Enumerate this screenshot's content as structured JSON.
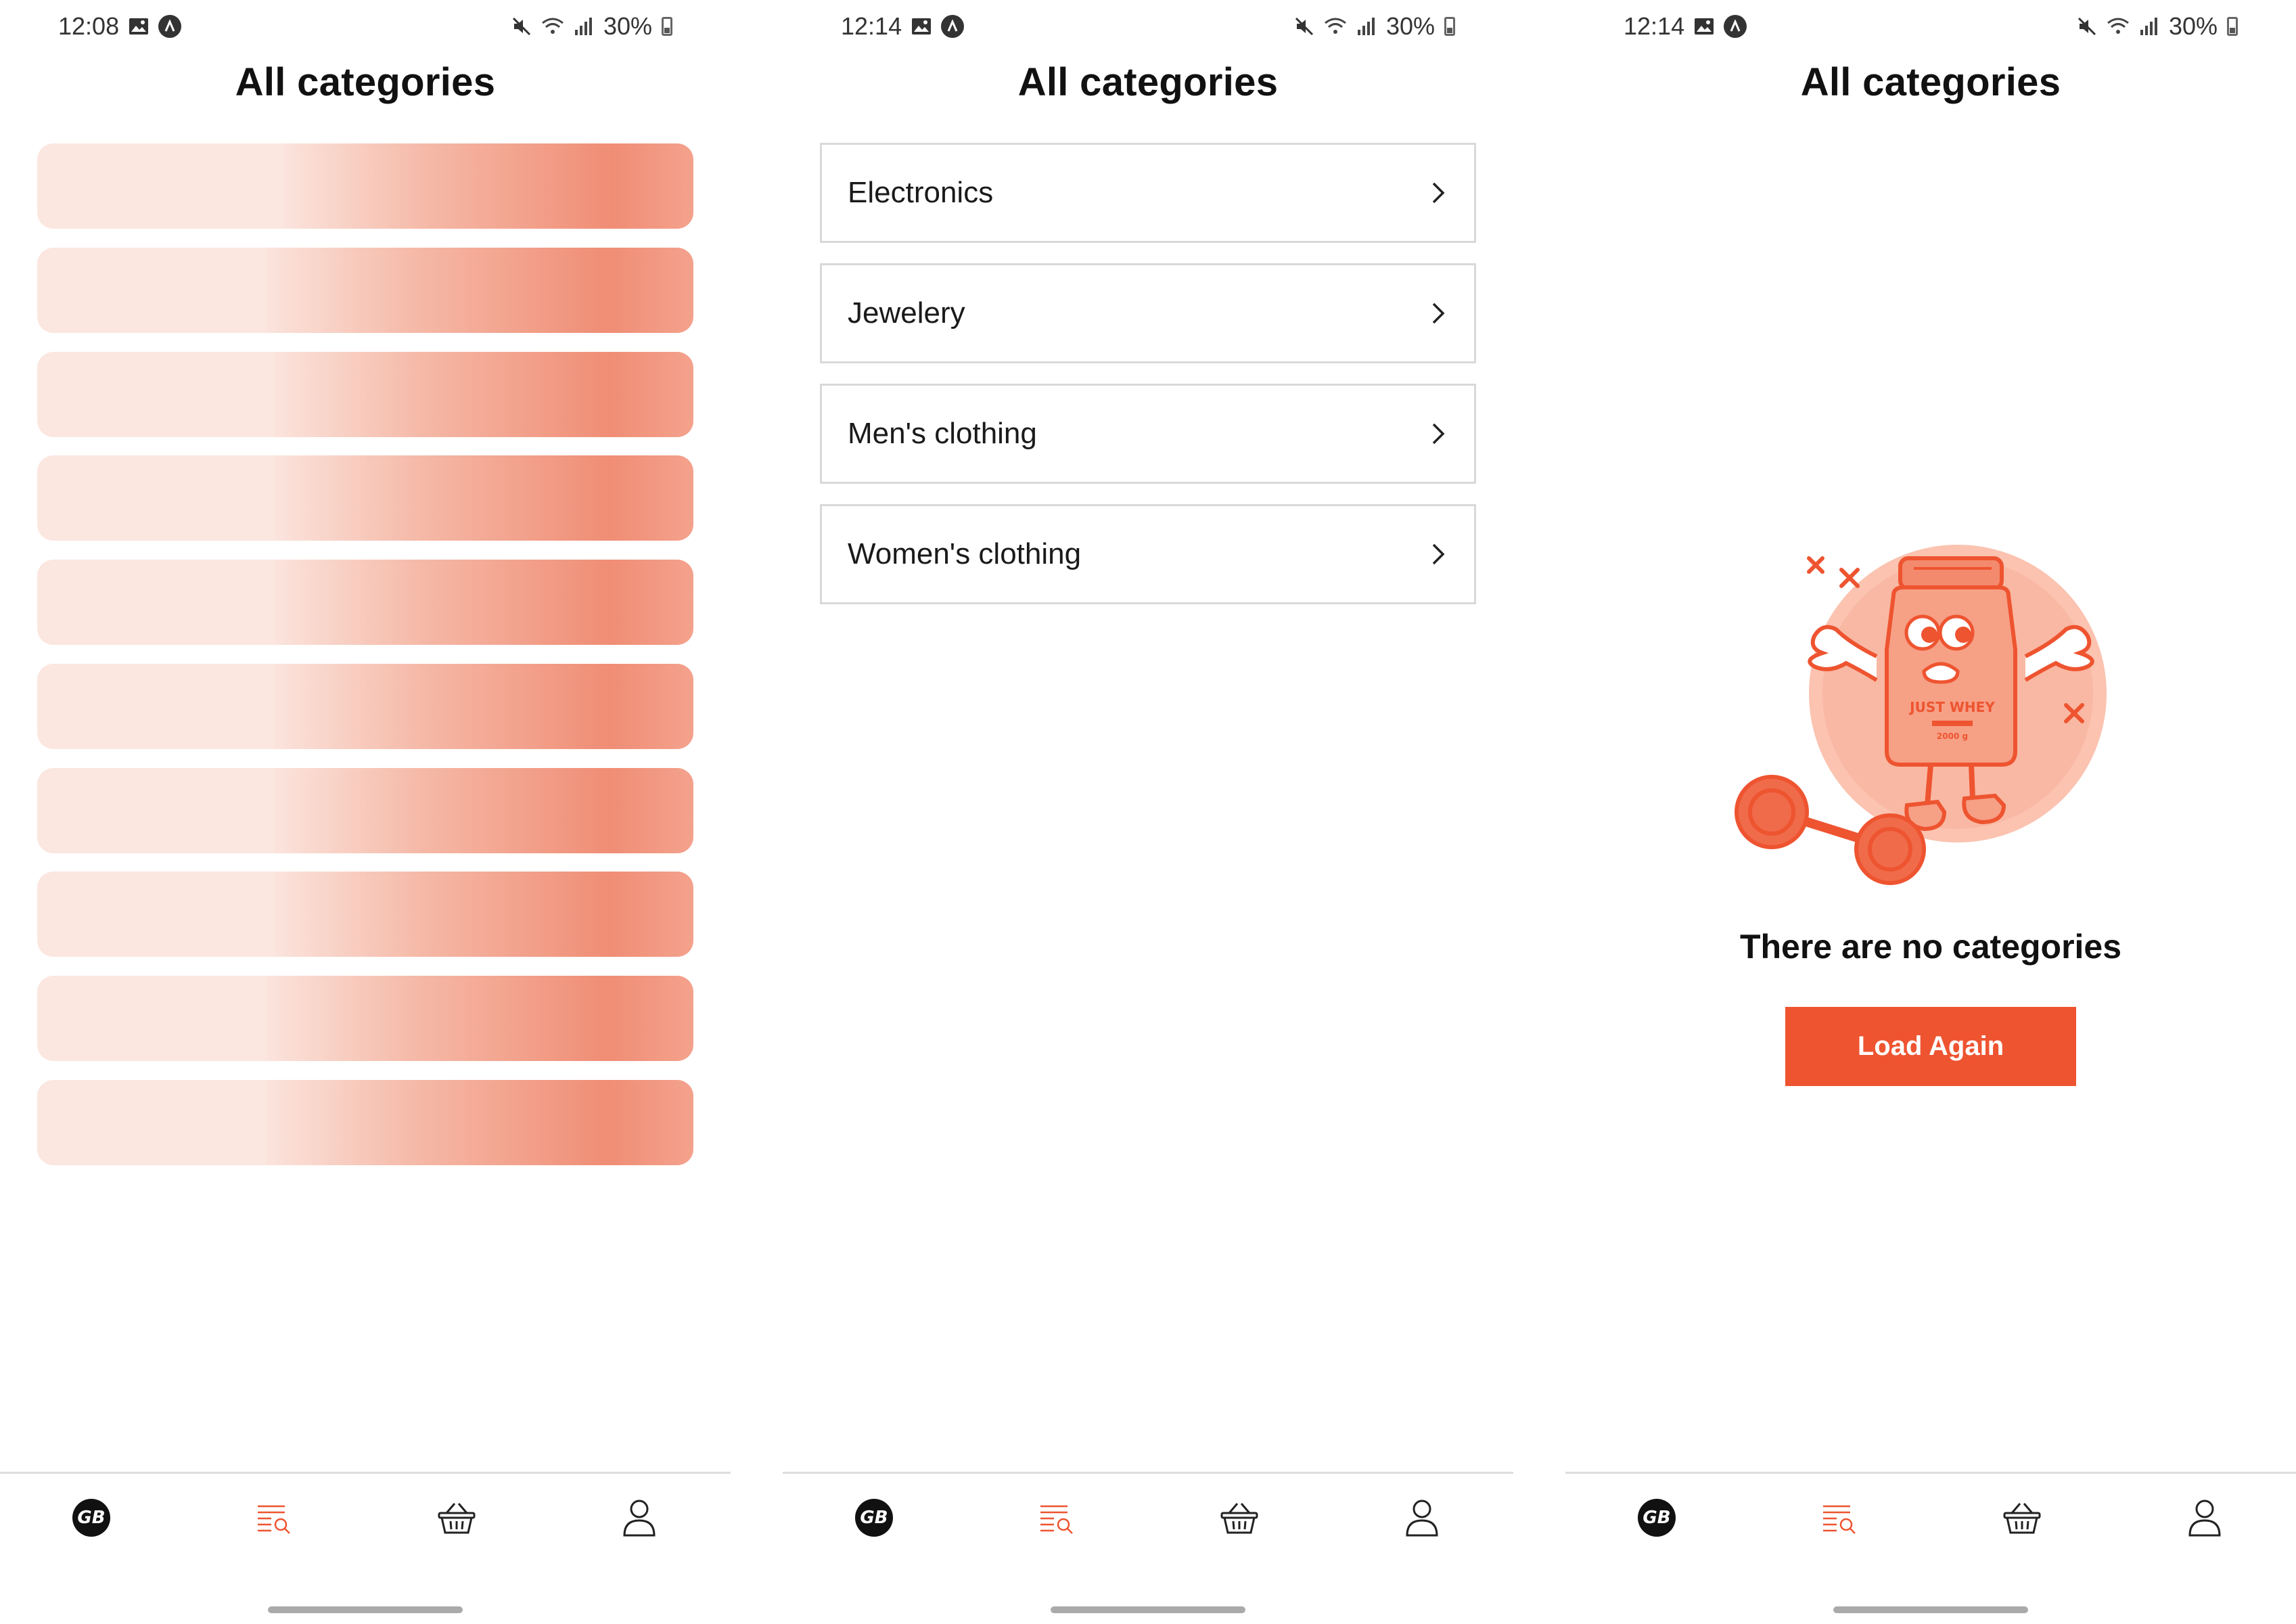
{
  "colors": {
    "accent": "#ee5430",
    "skeleton_light": "#fbe6e0",
    "skeleton_dark": "#f08d75",
    "border": "#d9d9d9",
    "text": "#111111"
  },
  "screens": [
    {
      "status": {
        "time": "12:08",
        "battery": "30%"
      },
      "title": "All categories",
      "state": "loading",
      "skeleton_count": 10
    },
    {
      "status": {
        "time": "12:14",
        "battery": "30%"
      },
      "title": "All categories",
      "state": "loaded",
      "categories": [
        {
          "label": "Electronics"
        },
        {
          "label": "Jewelery"
        },
        {
          "label": "Men's clothing"
        },
        {
          "label": "Women's clothing"
        }
      ]
    },
    {
      "status": {
        "time": "12:14",
        "battery": "30%"
      },
      "title": "All categories",
      "state": "empty",
      "empty_message": "There are no categories",
      "reload_label": "Load Again",
      "illustration": {
        "jar_label": "JUST WHEY",
        "jar_weight": "2000 g"
      }
    }
  ],
  "nav": {
    "logo": "GB",
    "items": [
      {
        "icon": "gb-logo-icon"
      },
      {
        "icon": "categories-search-icon",
        "active": true
      },
      {
        "icon": "basket-icon"
      },
      {
        "icon": "user-icon"
      }
    ]
  }
}
